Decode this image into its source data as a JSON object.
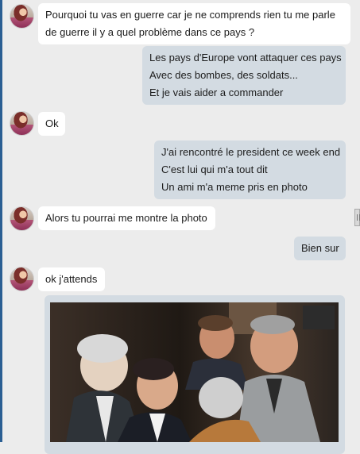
{
  "messages": [
    {
      "from": "contact",
      "lines": [
        "Pourquoi tu vas en guerre car je ne comprends rien tu me parle",
        "de guerre il y a quel problème dans ce pays ?"
      ]
    },
    {
      "from": "me",
      "lines": [
        "Les pays d'Europe vont attaquer ces pays",
        "Avec des bombes, des soldats...",
        "Et je vais aider a commander"
      ]
    },
    {
      "from": "contact",
      "lines": [
        "Ok"
      ]
    },
    {
      "from": "me",
      "lines": [
        "J'ai rencontré le president ce week end",
        "C'est lui qui m'a tout dit",
        "Un ami m'a meme pris en photo"
      ]
    },
    {
      "from": "contact",
      "lines": [
        "Alors tu pourrai me montre la photo"
      ]
    },
    {
      "from": "me",
      "lines": [
        "Bien sur"
      ]
    },
    {
      "from": "contact",
      "lines": [
        "ok j'attends"
      ]
    },
    {
      "from": "me",
      "type": "photo",
      "icon": "group-photo-image"
    }
  ],
  "colors": {
    "incoming": "#ffffff",
    "outgoing": "#d3dbe2",
    "background": "#ececec"
  }
}
